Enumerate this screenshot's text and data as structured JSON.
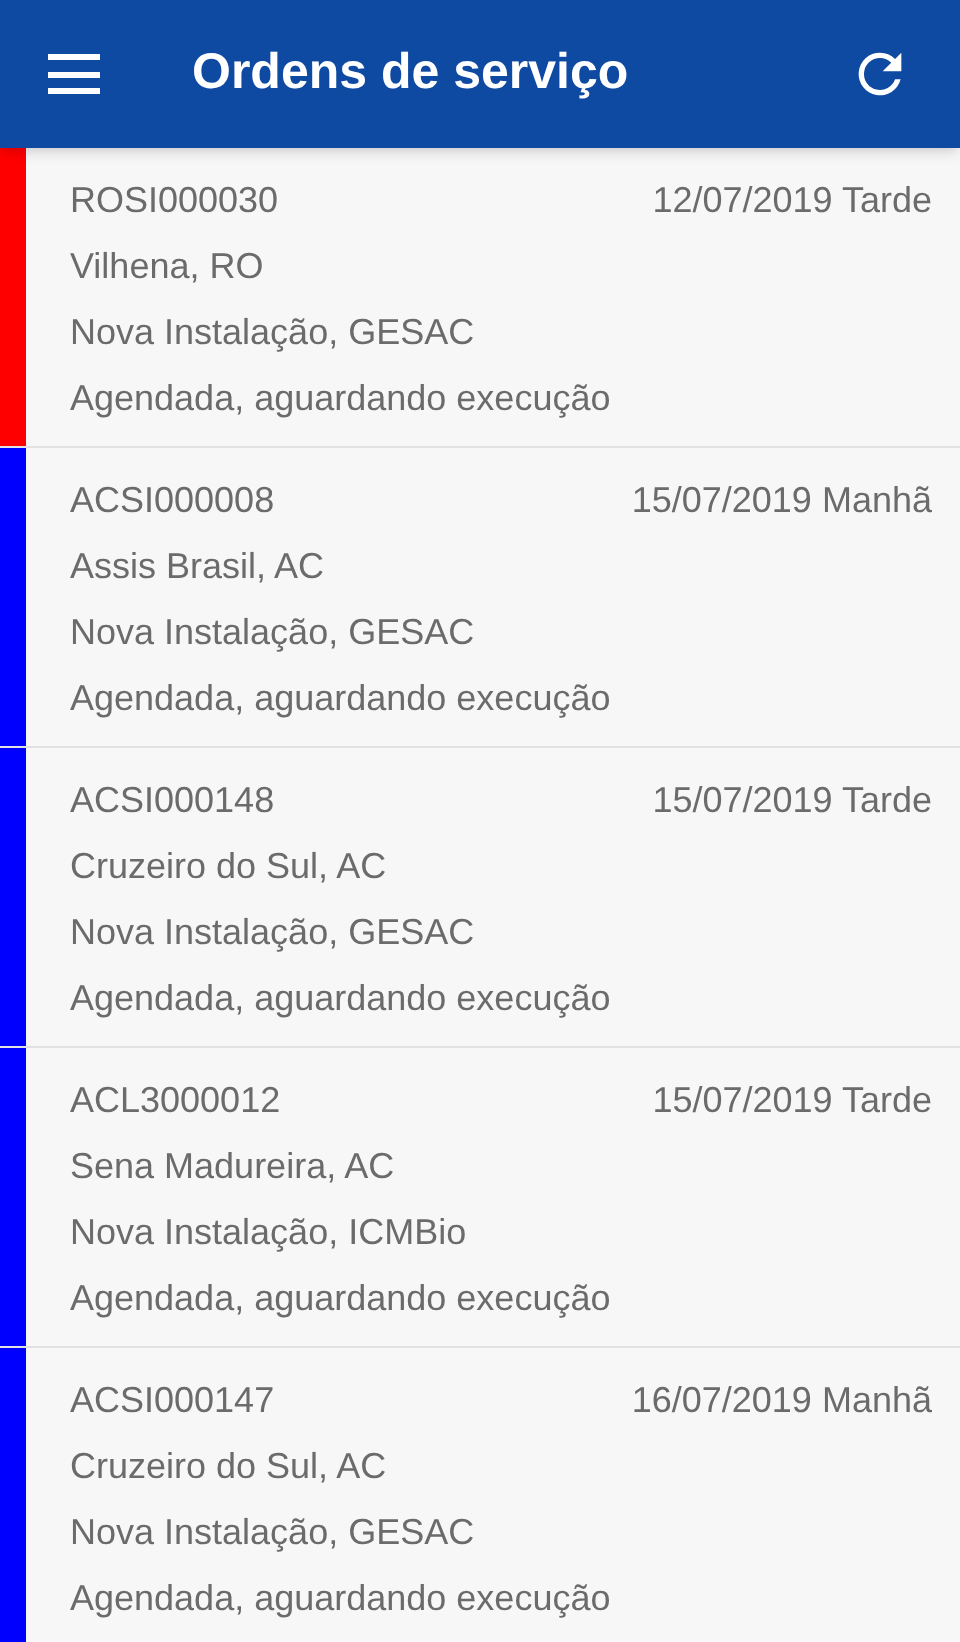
{
  "app_bar": {
    "title": "Ordens de serviço"
  },
  "orders": [
    {
      "code": "ROSI000030",
      "date": "12/07/2019 Tarde",
      "city": "Vilhena, RO",
      "service": "Nova Instalação, GESAC",
      "status": "Agendada, aguardando execução",
      "color": "#ff0000"
    },
    {
      "code": "ACSI000008",
      "date": "15/07/2019 Manhã",
      "city": "Assis Brasil, AC",
      "service": "Nova Instalação, GESAC",
      "status": "Agendada, aguardando execução",
      "color": "#0000ff"
    },
    {
      "code": "ACSI000148",
      "date": "15/07/2019 Tarde",
      "city": "Cruzeiro do Sul, AC",
      "service": "Nova Instalação, GESAC",
      "status": "Agendada, aguardando execução",
      "color": "#0000ff"
    },
    {
      "code": "ACL3000012",
      "date": "15/07/2019 Tarde",
      "city": "Sena Madureira, AC",
      "service": "Nova Instalação, ICMBio",
      "status": "Agendada, aguardando execução",
      "color": "#0000ff"
    },
    {
      "code": "ACSI000147",
      "date": "16/07/2019 Manhã",
      "city": "Cruzeiro do Sul, AC",
      "service": "Nova Instalação, GESAC",
      "status": "Agendada, aguardando execução",
      "color": "#0000ff"
    }
  ]
}
